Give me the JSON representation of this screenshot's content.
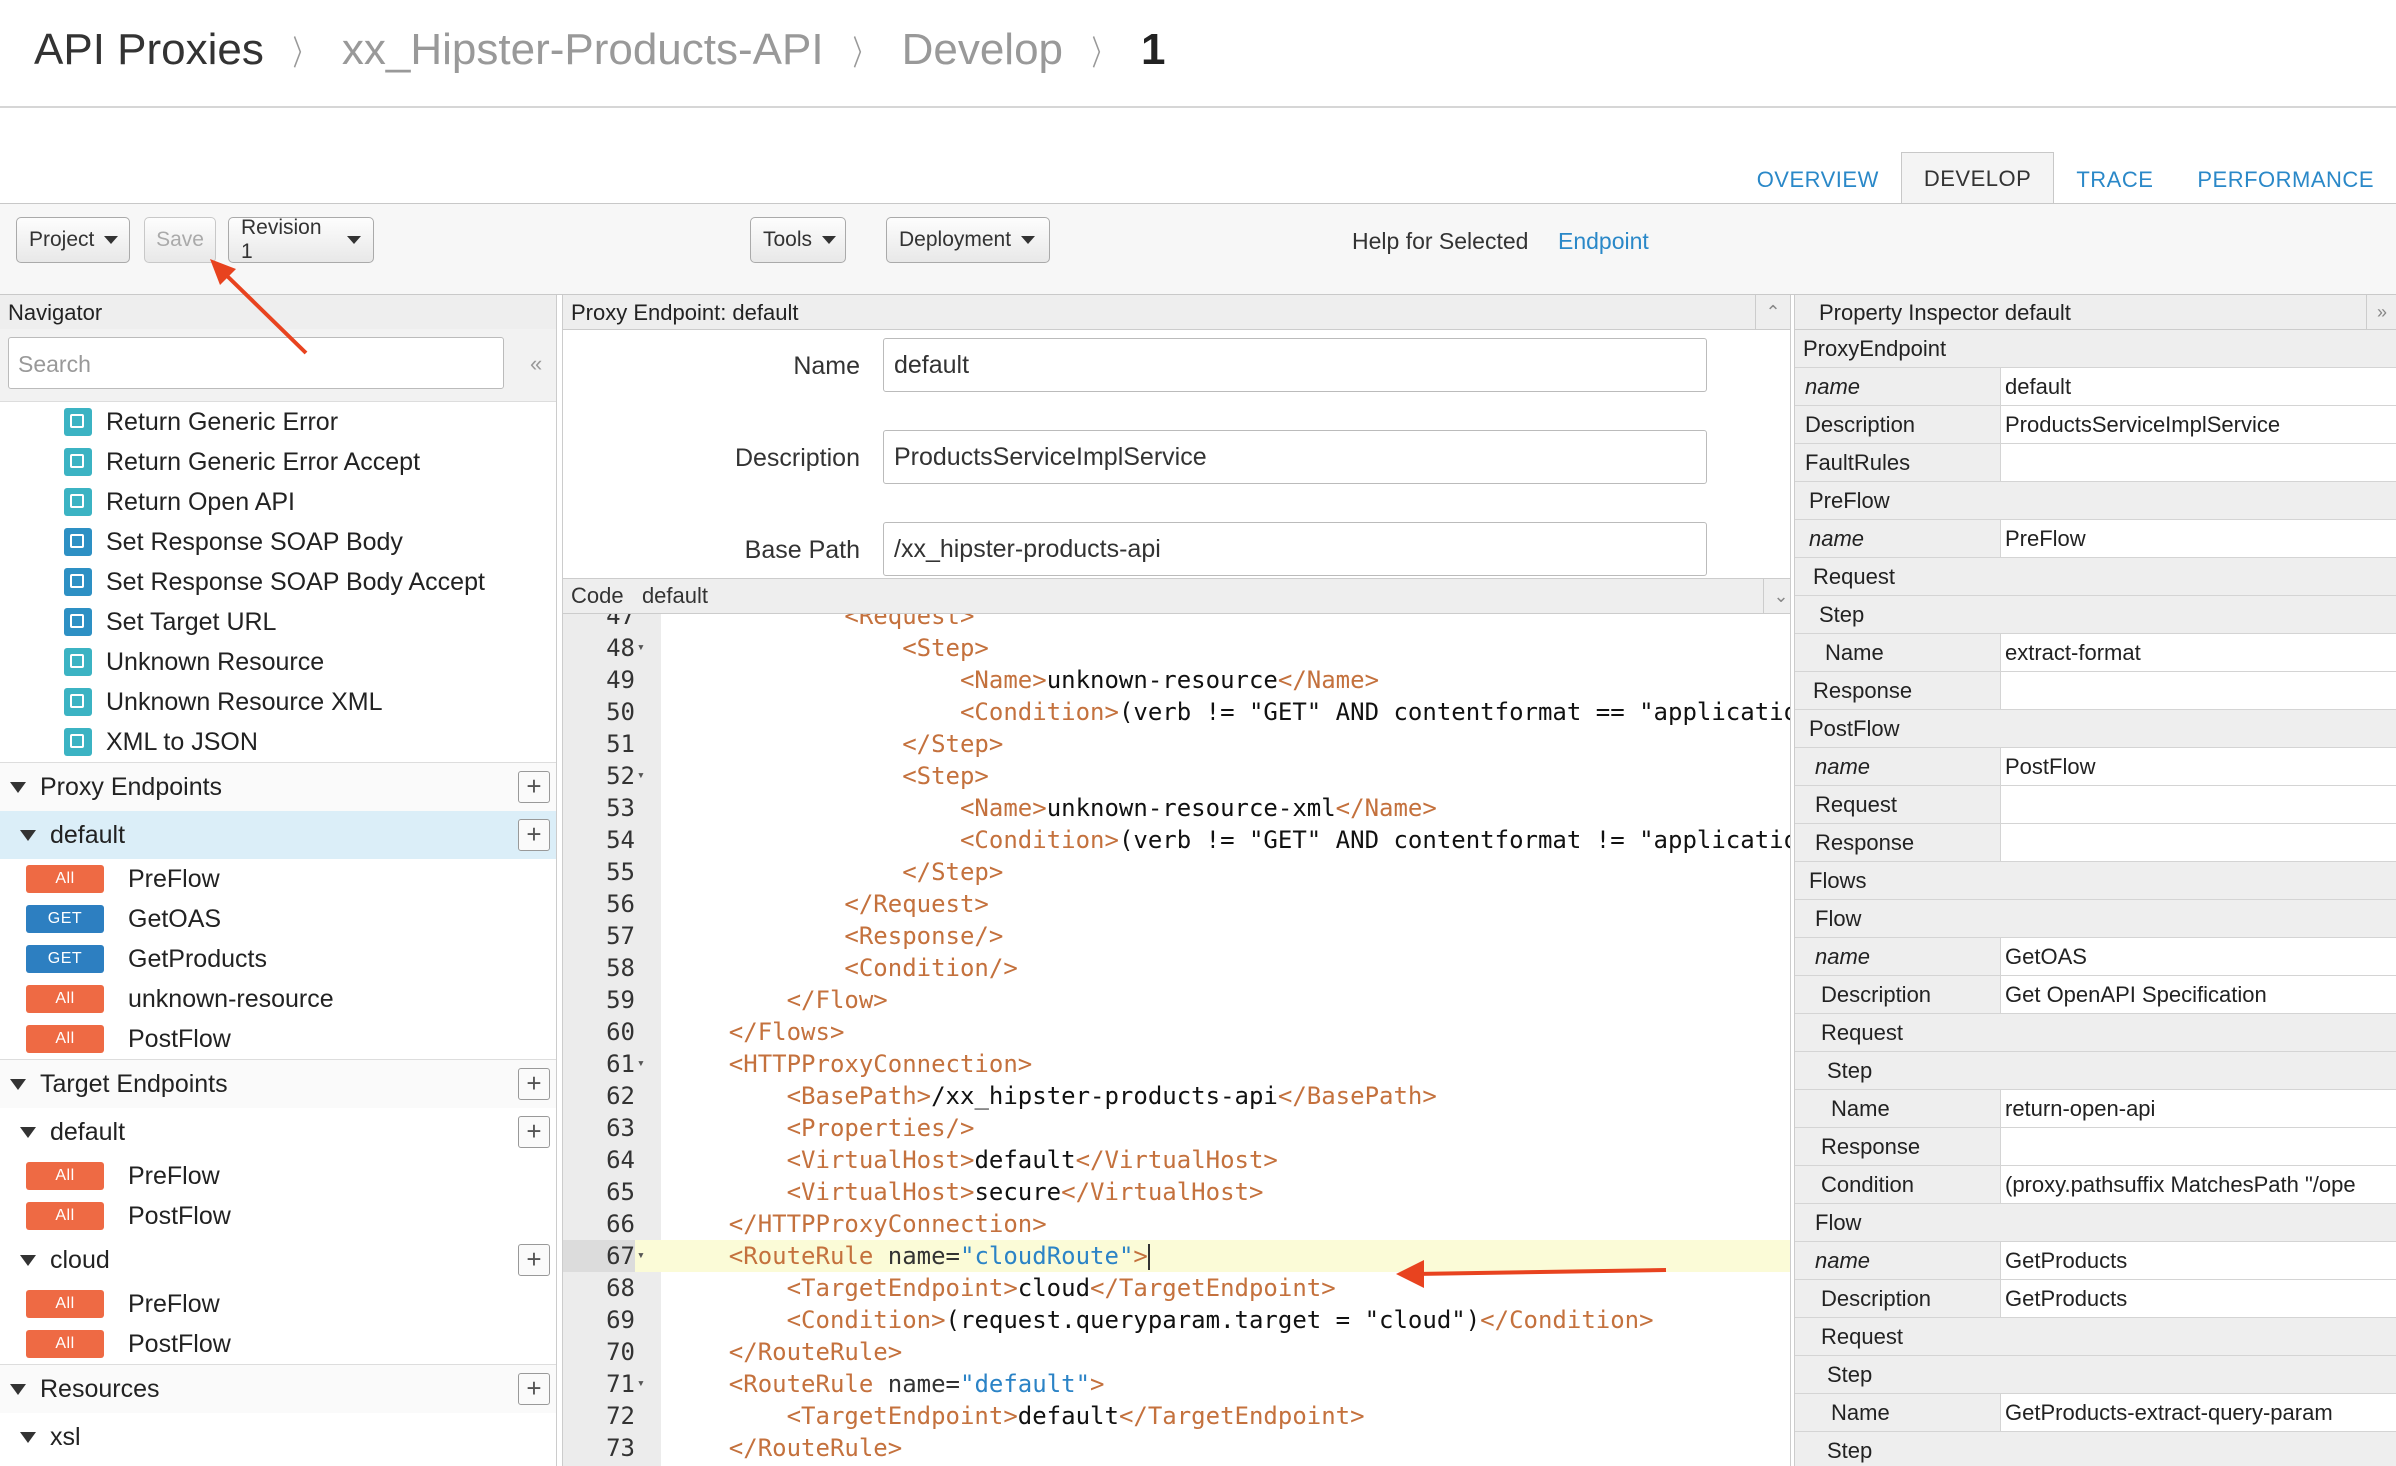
{
  "breadcrumb": {
    "root": "API Proxies",
    "proxy": "xx_Hipster-Products-API",
    "section": "Develop",
    "revision": "1"
  },
  "tabs": [
    "OVERVIEW",
    "DEVELOP",
    "TRACE",
    "PERFORMANCE"
  ],
  "active_tab": "DEVELOP",
  "toolbar": {
    "project": "Project",
    "save": "Save",
    "revision": "Revision 1",
    "tools": "Tools",
    "deployment": "Deployment",
    "help_label": "Help for Selected",
    "help_link": "Endpoint"
  },
  "navigator": {
    "title": "Navigator",
    "search_placeholder": "Search",
    "policies": [
      "Return Generic Error",
      "Return Generic Error Accept",
      "Return Open API",
      "Set Response SOAP Body",
      "Set Response SOAP Body Accept",
      "Set Target URL",
      "Unknown Resource",
      "Unknown Resource XML",
      "XML to JSON"
    ],
    "proxy_endpoints_label": "Proxy Endpoints",
    "proxy_default": "default",
    "proxy_flows": [
      {
        "verb": "All",
        "name": "PreFlow"
      },
      {
        "verb": "GET",
        "name": "GetOAS"
      },
      {
        "verb": "GET",
        "name": "GetProducts"
      },
      {
        "verb": "All",
        "name": "unknown-resource"
      },
      {
        "verb": "All",
        "name": "PostFlow"
      }
    ],
    "target_endpoints_label": "Target Endpoints",
    "target_default": "default",
    "target_default_flows": [
      {
        "verb": "All",
        "name": "PreFlow"
      },
      {
        "verb": "All",
        "name": "PostFlow"
      }
    ],
    "target_cloud": "cloud",
    "target_cloud_flows": [
      {
        "verb": "All",
        "name": "PreFlow"
      },
      {
        "verb": "All",
        "name": "PostFlow"
      }
    ],
    "resources_label": "Resources",
    "resources_xsl": "xsl"
  },
  "proxy_endpoint": {
    "header": "Proxy Endpoint: default",
    "name_label": "Name",
    "name_value": "default",
    "description_label": "Description",
    "description_value": "ProductsServiceImplService",
    "basepath_label": "Base Path",
    "basepath_value": "/xx_hipster-products-api"
  },
  "code": {
    "header_label": "Code",
    "header_name": "default",
    "lines": [
      {
        "n": "47",
        "fold": false,
        "html": "            <span class='t'>&lt;Request&gt;</span>"
      },
      {
        "n": "48",
        "fold": true,
        "html": "                <span class='t'>&lt;Step&gt;</span>"
      },
      {
        "n": "49",
        "fold": false,
        "html": "                    <span class='t'>&lt;Name&gt;</span><span class='x'>unknown-resource</span><span class='t'>&lt;/Name&gt;</span>"
      },
      {
        "n": "50",
        "fold": false,
        "html": "                    <span class='t'>&lt;Condition&gt;</span><span class='x'>(verb != \"GET\" AND contentformat == \"applicatio</span>"
      },
      {
        "n": "51",
        "fold": false,
        "html": "                <span class='t'>&lt;/Step&gt;</span>"
      },
      {
        "n": "52",
        "fold": true,
        "html": "                <span class='t'>&lt;Step&gt;</span>"
      },
      {
        "n": "53",
        "fold": false,
        "html": "                    <span class='t'>&lt;Name&gt;</span><span class='x'>unknown-resource-xml</span><span class='t'>&lt;/Name&gt;</span>"
      },
      {
        "n": "54",
        "fold": false,
        "html": "                    <span class='t'>&lt;Condition&gt;</span><span class='x'>(verb != \"GET\" AND contentformat != \"applicatio</span>"
      },
      {
        "n": "55",
        "fold": false,
        "html": "                <span class='t'>&lt;/Step&gt;</span>"
      },
      {
        "n": "56",
        "fold": false,
        "html": "            <span class='t'>&lt;/Request&gt;</span>"
      },
      {
        "n": "57",
        "fold": false,
        "html": "            <span class='t'>&lt;Response/&gt;</span>"
      },
      {
        "n": "58",
        "fold": false,
        "html": "            <span class='t'>&lt;Condition/&gt;</span>"
      },
      {
        "n": "59",
        "fold": false,
        "html": "        <span class='t'>&lt;/Flow&gt;</span>"
      },
      {
        "n": "60",
        "fold": false,
        "html": "    <span class='t'>&lt;/Flows&gt;</span>"
      },
      {
        "n": "61",
        "fold": true,
        "html": "    <span class='t'>&lt;HTTPProxyConnection&gt;</span>"
      },
      {
        "n": "62",
        "fold": false,
        "html": "        <span class='t'>&lt;BasePath&gt;</span><span class='x'>/xx_hipster-products-api</span><span class='t'>&lt;/BasePath&gt;</span>"
      },
      {
        "n": "63",
        "fold": false,
        "html": "        <span class='t'>&lt;Properties/&gt;</span>"
      },
      {
        "n": "64",
        "fold": false,
        "html": "        <span class='t'>&lt;VirtualHost&gt;</span><span class='x'>default</span><span class='t'>&lt;/VirtualHost&gt;</span>"
      },
      {
        "n": "65",
        "fold": false,
        "html": "        <span class='t'>&lt;VirtualHost&gt;</span><span class='x'>secure</span><span class='t'>&lt;/VirtualHost&gt;</span>"
      },
      {
        "n": "66",
        "fold": false,
        "html": "    <span class='t'>&lt;/HTTPProxyConnection&gt;</span>"
      },
      {
        "n": "67",
        "fold": true,
        "html": "    <span class='t'>&lt;RouteRule</span> <span class='a'>name=</span><span class='v'>\"cloudRoute\"</span><span class='t'>&gt;</span><span class='cursor'></span>",
        "active": true
      },
      {
        "n": "68",
        "fold": false,
        "html": "        <span class='t'>&lt;TargetEndpoint&gt;</span><span class='x'>cloud</span><span class='t'>&lt;/TargetEndpoint&gt;</span>"
      },
      {
        "n": "69",
        "fold": false,
        "html": "        <span class='t'>&lt;Condition&gt;</span><span class='x'>(request.queryparam.target = \"cloud\")</span><span class='t'>&lt;/Condition&gt;</span>"
      },
      {
        "n": "70",
        "fold": false,
        "html": "    <span class='t'>&lt;/RouteRule&gt;</span>"
      },
      {
        "n": "71",
        "fold": true,
        "html": "    <span class='t'>&lt;RouteRule</span> <span class='a'>name=</span><span class='v'>\"default\"</span><span class='t'>&gt;</span>"
      },
      {
        "n": "72",
        "fold": false,
        "html": "        <span class='t'>&lt;TargetEndpoint&gt;</span><span class='x'>default</span><span class='t'>&lt;/TargetEndpoint&gt;</span>"
      },
      {
        "n": "73",
        "fold": false,
        "html": "    <span class='t'>&lt;/RouteRule&gt;</span>"
      }
    ]
  },
  "inspector": {
    "header": "Property Inspector  default",
    "rows": [
      {
        "k": "ProxyEndpoint",
        "v": null,
        "ind": 8,
        "it": false
      },
      {
        "k": "name",
        "v": "default",
        "ind": 10,
        "it": true
      },
      {
        "k": "Description",
        "v": "ProductsServiceImplService",
        "ind": 10,
        "it": false
      },
      {
        "k": "FaultRules",
        "v": "",
        "ind": 10,
        "it": false
      },
      {
        "k": "PreFlow",
        "v": null,
        "ind": 14,
        "it": false
      },
      {
        "k": "name",
        "v": "PreFlow",
        "ind": 14,
        "it": true
      },
      {
        "k": "Request",
        "v": null,
        "ind": 18,
        "it": false
      },
      {
        "k": "Step",
        "v": null,
        "ind": 24,
        "it": false
      },
      {
        "k": "Name",
        "v": "extract-format",
        "ind": 30,
        "it": false
      },
      {
        "k": "Response",
        "v": "",
        "ind": 18,
        "it": false
      },
      {
        "k": "PostFlow",
        "v": null,
        "ind": 14,
        "it": false
      },
      {
        "k": "name",
        "v": "PostFlow",
        "ind": 20,
        "it": true
      },
      {
        "k": "Request",
        "v": "",
        "ind": 20,
        "it": false
      },
      {
        "k": "Response",
        "v": "",
        "ind": 20,
        "it": false
      },
      {
        "k": "Flows",
        "v": null,
        "ind": 14,
        "it": false
      },
      {
        "k": "Flow",
        "v": null,
        "ind": 20,
        "it": false
      },
      {
        "k": "name",
        "v": "GetOAS",
        "ind": 20,
        "it": true
      },
      {
        "k": "Description",
        "v": "Get OpenAPI Specification",
        "ind": 26,
        "it": false
      },
      {
        "k": "Request",
        "v": null,
        "ind": 26,
        "it": false
      },
      {
        "k": "Step",
        "v": null,
        "ind": 32,
        "it": false
      },
      {
        "k": "Name",
        "v": "return-open-api",
        "ind": 36,
        "it": false
      },
      {
        "k": "Response",
        "v": "",
        "ind": 26,
        "it": false
      },
      {
        "k": "Condition",
        "v": "(proxy.pathsuffix MatchesPath \"/ope",
        "ind": 26,
        "it": false
      },
      {
        "k": "Flow",
        "v": null,
        "ind": 20,
        "it": false
      },
      {
        "k": "name",
        "v": "GetProducts",
        "ind": 20,
        "it": true
      },
      {
        "k": "Description",
        "v": "GetProducts",
        "ind": 26,
        "it": false
      },
      {
        "k": "Request",
        "v": null,
        "ind": 26,
        "it": false
      },
      {
        "k": "Step",
        "v": null,
        "ind": 32,
        "it": false
      },
      {
        "k": "Name",
        "v": "GetProducts-extract-query-param",
        "ind": 36,
        "it": false
      },
      {
        "k": "Step",
        "v": null,
        "ind": 32,
        "it": false
      }
    ]
  },
  "colors": {
    "link": "#2a88c8",
    "verb_all": "#ee6a44",
    "verb_get": "#2d7fc1",
    "xml_tag": "#c4713d",
    "attr_value": "#2b83c6",
    "annotation_arrow": "#e8431f"
  }
}
